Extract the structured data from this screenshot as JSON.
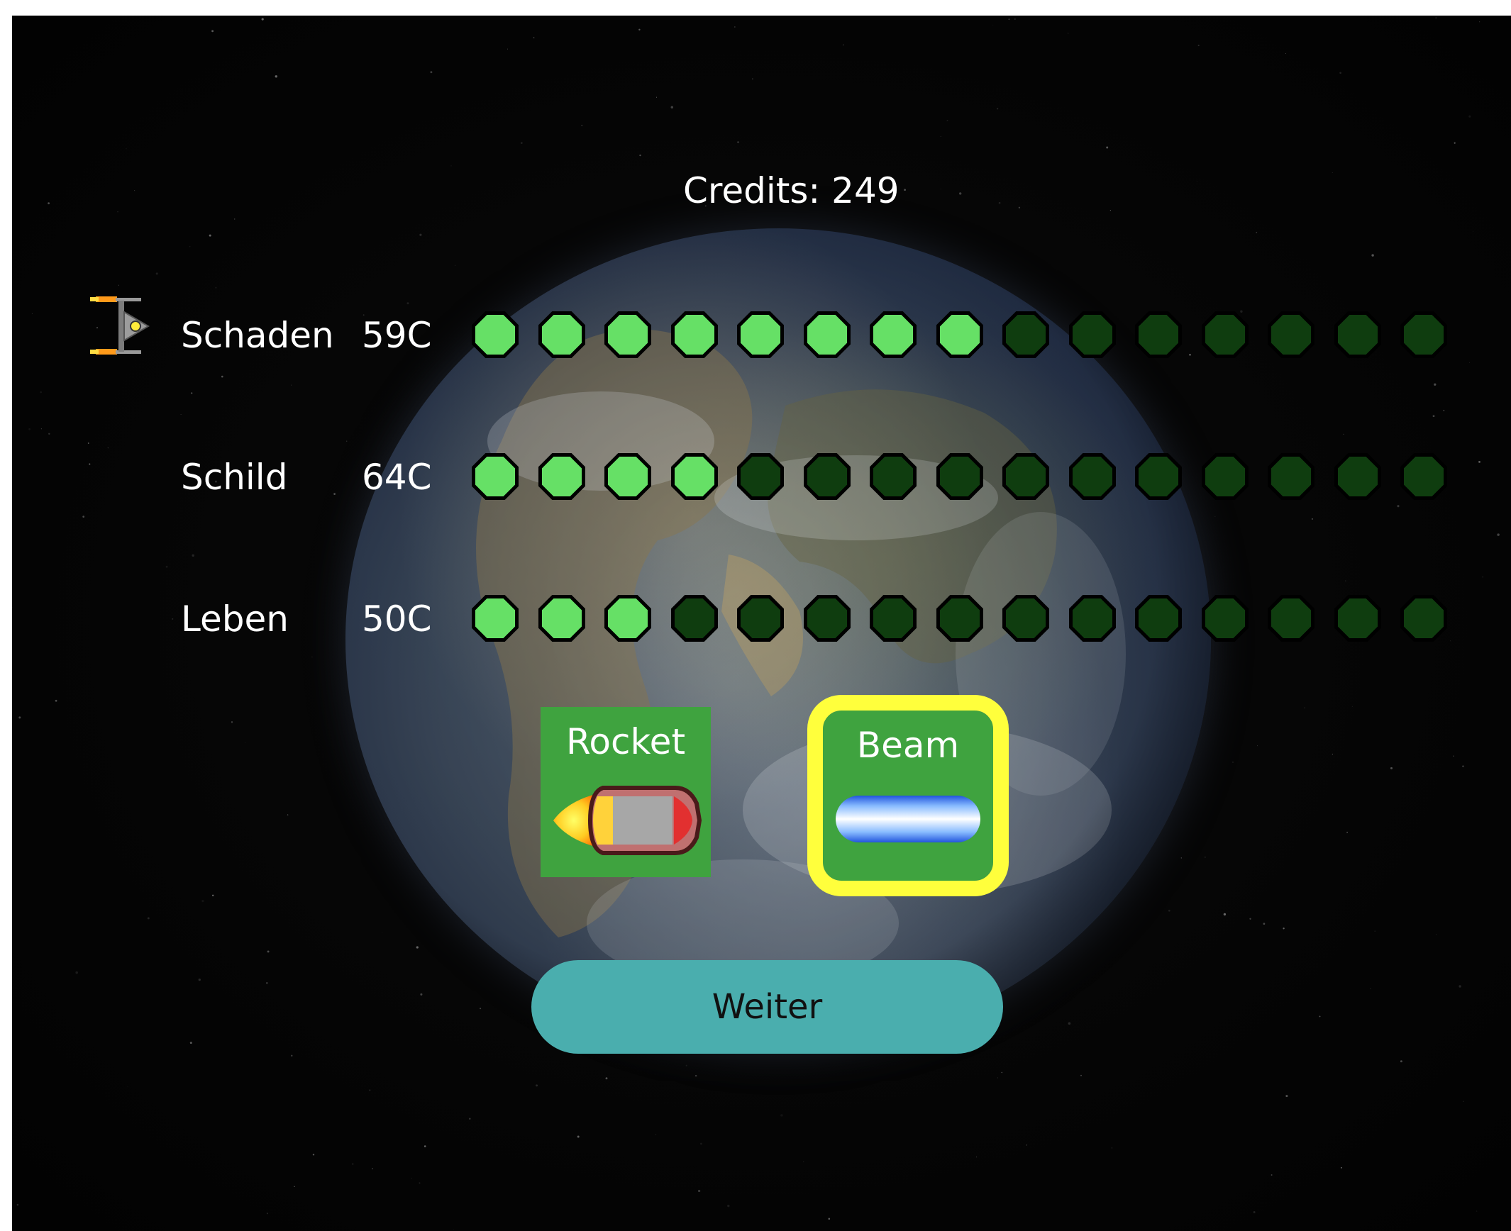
{
  "hud": {
    "credits_text": "Credits: 249"
  },
  "stats": [
    {
      "name": "Schaden",
      "cost": "59C",
      "filled": 8,
      "total": 15
    },
    {
      "name": "Schild",
      "cost": "64C",
      "filled": 4,
      "total": 15
    },
    {
      "name": "Leben",
      "cost": "50C",
      "filled": 3,
      "total": 15
    }
  ],
  "weapons": {
    "rocket": {
      "label": "Rocket",
      "selected": false
    },
    "beam": {
      "label": "Beam",
      "selected": true
    }
  },
  "buttons": {
    "continue_label": "Weiter"
  },
  "colors": {
    "pip_filled": "#66e066",
    "pip_empty": "#0f3d0f",
    "pip_outline": "#000000",
    "weapon_bg": "#3fa33f",
    "selected_border": "#ffff3c",
    "button_bg": "#4aaeae",
    "text": "#ffffff"
  },
  "icons": {
    "ship": "spaceship-icon"
  }
}
